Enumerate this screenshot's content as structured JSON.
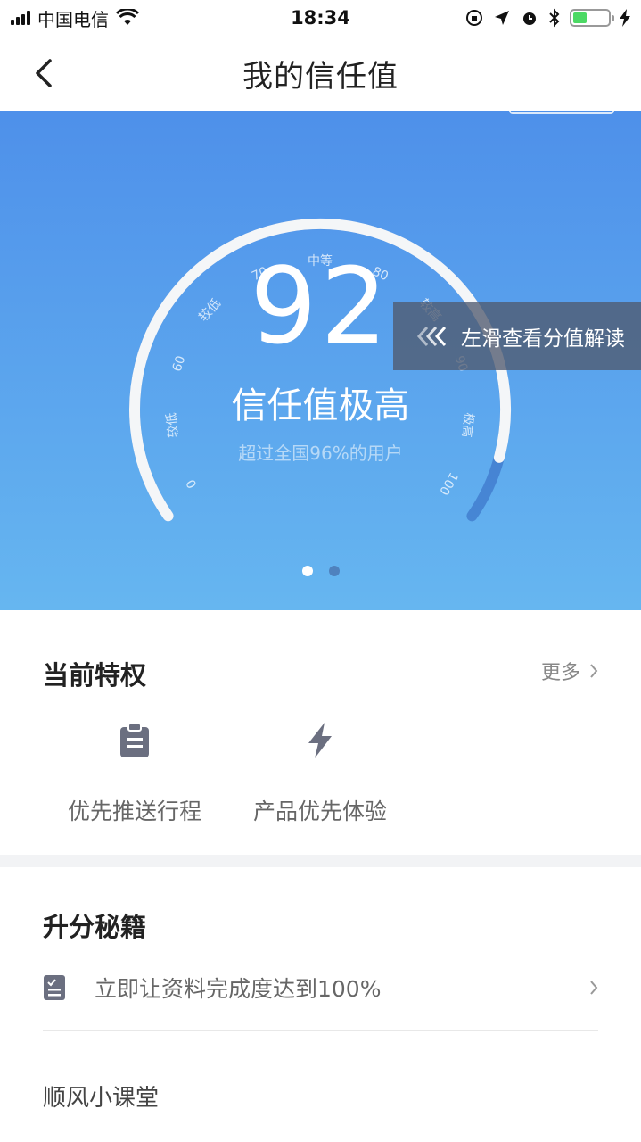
{
  "status_bar": {
    "carrier": "中国电信",
    "time": "18:34"
  },
  "nav": {
    "title": "我的信任值"
  },
  "gauge": {
    "score": "92",
    "level_text": "信任值极高",
    "rank_text": "超过全国96%的用户",
    "scale_labels": [
      "0",
      "较低",
      "60",
      "较低",
      "70",
      "中等",
      "80",
      "较高",
      "90",
      "极高",
      "100"
    ],
    "swipe_hint": "左滑查看分值解读"
  },
  "pager": {
    "count": 2,
    "active_index": 0
  },
  "privileges": {
    "title": "当前特权",
    "more_label": "更多",
    "items": [
      {
        "label": "优先推送行程",
        "icon": "clipboard-icon"
      },
      {
        "label": "产品优先体验",
        "icon": "lightning-icon"
      }
    ]
  },
  "tips": {
    "title": "升分秘籍",
    "items": [
      {
        "label": "立即让资料完成度达到100%",
        "icon": "checklist-icon"
      }
    ],
    "class_title": "顺风小课堂"
  },
  "colors": {
    "hero_top": "#4e90ea",
    "hero_bottom": "#66b6f0",
    "icon_gray": "#6b6f80"
  }
}
